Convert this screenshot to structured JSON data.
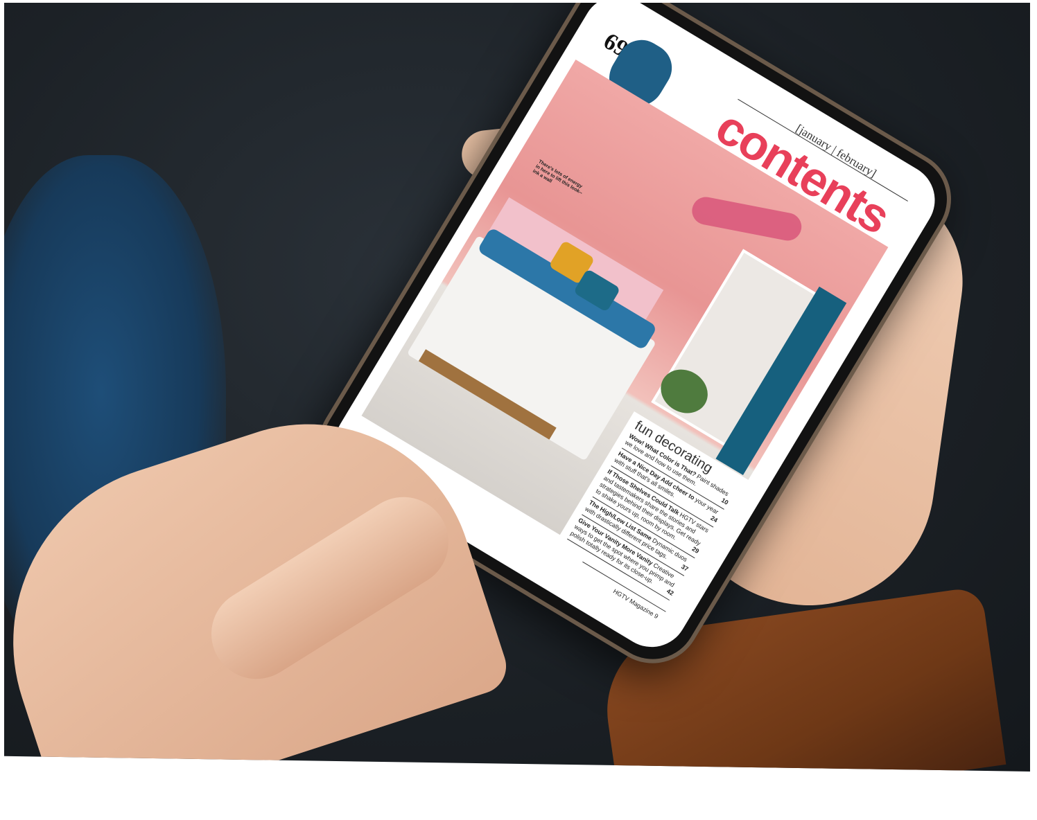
{
  "scene": {
    "description_colors": {
      "background": "#1c2126",
      "sleeve": "#8b4a22",
      "skin": "#e9c2a6",
      "phone_frame": "#121212"
    }
  },
  "magazine_page": {
    "date_label": "[january | february]",
    "title": "contents",
    "page_number": "69",
    "title_color": "#e8405a",
    "caption": "There's lots of energy in here to lift this look-- ink a wall",
    "section_title": "fun decorating",
    "entries": [
      {
        "headline": "Wow! What Color is That?",
        "blurb": "Paint shades we love and how to use them.",
        "page": "10"
      },
      {
        "headline": "Have a Nice Day Add cheer to",
        "blurb": "your year with stuff that's all smiles.",
        "page": "24"
      },
      {
        "headline": "If Those Shelves Could Talk",
        "blurb": "HGTV stars and tastemakers share the stories and strategies behind their displays. Get ready to shake yours up, room by room.",
        "page": "29"
      },
      {
        "headline": "The High/Low List Same",
        "blurb": "Dynamic duos with drastically different price tags.",
        "page": "37"
      },
      {
        "headline": "Give Your Vanity More Vanity",
        "blurb": "Creative ways to get the spot where you primp and polish totally ready for its close-up.",
        "page": "42"
      }
    ],
    "footer": "HGTV Magazine 9"
  }
}
